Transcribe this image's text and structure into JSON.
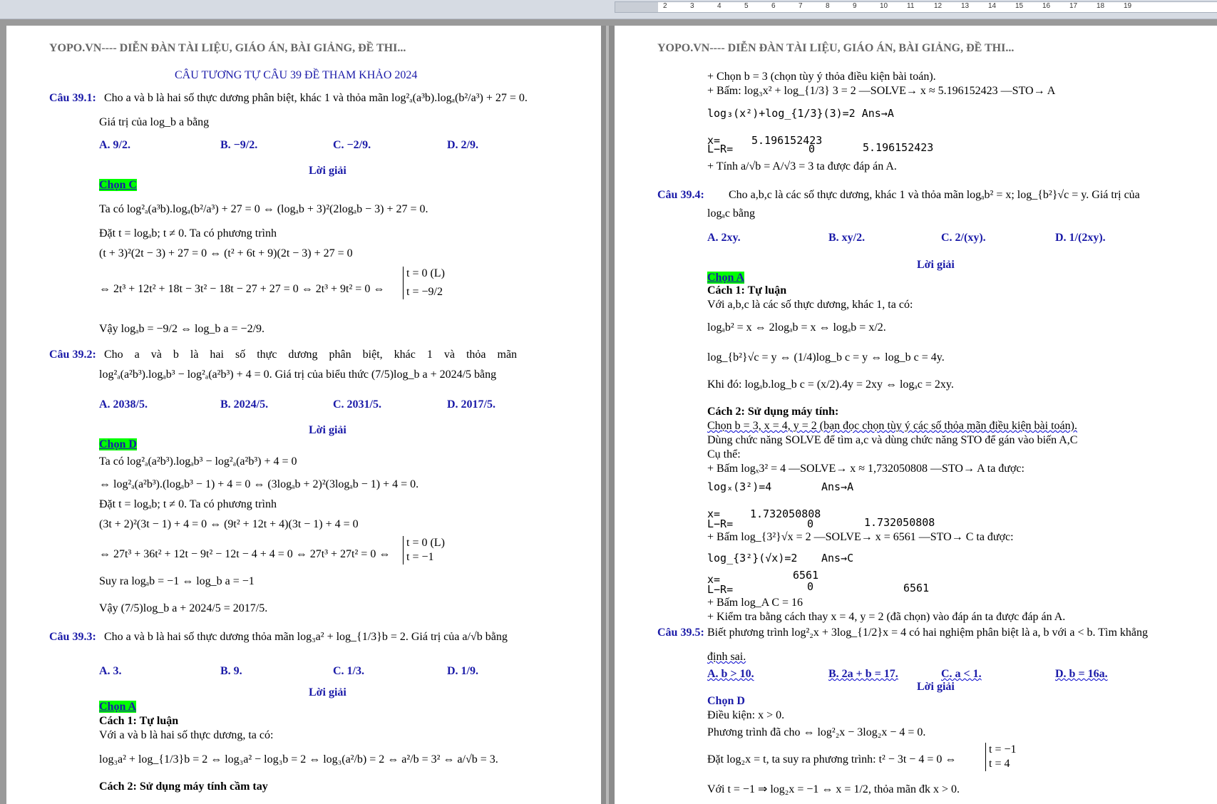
{
  "header_text": "YOPO.VN---- DIỄN ĐÀN TÀI LIỆU, GIÁO ÁN, BÀI GIẢNG, ĐỀ THI...",
  "ruler": {
    "numbers": [
      "2",
      "3",
      "4",
      "5",
      "6",
      "7",
      "8",
      "9",
      "10",
      "11",
      "12",
      "13",
      "14",
      "15",
      "16",
      "17",
      "18",
      "19"
    ]
  },
  "left": {
    "title": "CÂU TƯƠNG TỰ CÂU 39 ĐỀ THAM KHẢO 2024",
    "lines": [
      "Câu 39.1:",
      "Cho a và b là hai số thực dương phân biệt, khác 1 và thỏa mãn log²ₐ(a³b).logₐ(b²/a³) + 27 = 0.",
      "Giá trị của log_b a bằng",
      "A. 9/2.",
      "B. −9/2.",
      "C. −2/9.",
      "D. 2/9.",
      "Lời giải",
      "Chọn C",
      "Ta có log²ₐ(a³b).logₐ(b²/a³) + 27 = 0 ⇔ (logₐb + 3)²(2logₐb − 3) + 27 = 0.",
      "Đặt t = logₐb; t ≠ 0. Ta có phương trình",
      "(t + 3)²(2t − 3) + 27 = 0 ⇔ (t² + 6t + 9)(2t − 3) + 27 = 0",
      "⇔ 2t³ + 12t² + 18t − 3t² − 18t − 27 + 27 = 0 ⇔ 2t³ + 9t² = 0 ⇔",
      "t = 0 (L)",
      "t = −9/2",
      "Vậy logₐb = −9/2 ⇔ log_b a = −2/9.",
      "Câu 39.2:",
      "Cho a và b là hai số thực dương phân biệt, khác 1 và thỏa mãn",
      "log²ₐ(a²b³).logₐb³ − log²ₐ(a²b³) + 4 = 0. Giá trị của biểu thức (7/5)log_b a + 2024/5 bằng",
      "A. 2038/5.",
      "B. 2024/5.",
      "C. 2031/5.",
      "D. 2017/5.",
      "Lời giải",
      "Chọn D",
      "Ta có log²ₐ(a²b³).logₐb³ − log²ₐ(a²b³) + 4 = 0",
      "⇔ log²ₐ(a²b³).(logₐb³ − 1) + 4 = 0 ⇔ (3logₐb + 2)²(3logₐb − 1) + 4 = 0.",
      "Đặt t = logₐb; t ≠ 0. Ta có phương trình",
      "(3t + 2)²(3t − 1) + 4 = 0 ⇔ (9t² + 12t + 4)(3t − 1) + 4 = 0",
      "⇔ 27t³ + 36t² + 12t − 9t² − 12t − 4 + 4 = 0 ⇔ 27t³ + 27t² = 0 ⇔",
      "t = 0 (L)",
      "t = −1",
      "Suy ra logₐb = −1 ⇔ log_b a = −1",
      "Vậy (7/5)log_b a + 2024/5 = 2017/5.",
      "Câu 39.3:",
      "Cho a và b là hai số thực dương thỏa mãn log₃a² + log_{1/3}b = 2. Giá trị của a/√b bằng",
      "A. 3.",
      "B. 9.",
      "C. 1/3.",
      "D. 1/9.",
      "Lời giải",
      "Chọn A",
      "Cách 1: Tự luận",
      "Với a và b là hai số thực dương, ta có:",
      "log₃a² + log_{1/3}b = 2 ⇔ log₃a² − log₃b = 2 ⇔ log₃(a²/b) = 2 ⇔ a²/b = 3² ⇔ a/√b = 3.",
      "Cách 2: Sử dụng máy tính cầm tay"
    ]
  },
  "right": {
    "lines": [
      "+ Chọn b = 3 (chọn tùy ý thỏa điều kiện bài toán).",
      "+ Bấm: log₃x² + log_{1/3} 3 = 2 —SOLVE→ x ≈ 5.196152423 —STO→ A",
      "log₃(x²)+log_{1/3}(3)=2 Ans→A",
      "x=",
      "5.196152423",
      "L−R=",
      "0",
      "5.196152423",
      "+ Tính a/√b = A/√3 = 3 ta được đáp án A.",
      "Câu 39.4:",
      "Cho a,b,c là các số thực dương, khác 1 và thỏa mãn logₐb² = x; log_{b²}√c = y. Giá trị của",
      "logₐc bằng",
      "A. 2xy.",
      "B. xy/2.",
      "C. 2/(xy).",
      "D. 1/(2xy).",
      "Lời giải",
      "Chọn A",
      "Cách 1: Tự luận",
      "Với a,b,c là các số thực dương, khác 1, ta có:",
      "logₐb² = x ⇔ 2logₐb = x ⇔ logₐb = x/2.",
      "log_{b²}√c = y ⇔ (1/4)log_b c = y ⇔ log_b c = 4y.",
      "Khi đó: logₐb.log_b c = (x/2).4y = 2xy ⇔ logₐc = 2xy.",
      "Cách 2: Sử dụng máy tính:",
      "Chọn b = 3, x = 4, y = 2 (bạn đọc chọn tùy ý các số thỏa mãn điều kiện bài toán).",
      "Dùng chức năng SOLVE để tìm a,c và dùng chức năng STO để gán vào biến A,C",
      "Cụ thể:",
      "+ Bấm logₓ3² = 4 —SOLVE→ x ≈ 1,732050808 —STO→ A ta được:",
      "logₓ(3²)=4",
      "Ans→A",
      "x=",
      "1.732050808",
      "L−R=",
      "0",
      "1.732050808",
      "+ Bấm log_{3²}√x = 2 —SOLVE→ x = 6561 —STO→ C ta được:",
      "log_{3²}(√x)=2",
      "Ans→C",
      "x=",
      "6561",
      "L−R=",
      "0",
      "6561",
      "+ Bấm log_A C = 16",
      "+ Kiểm tra bằng cách thay x = 4, y = 2 (đã chọn) vào đáp án ta được đáp án A.",
      "Câu 39.5:",
      "Biết phương trình log²₂x + 3log_{1/2}x = 4 có hai nghiệm phân biệt là a, b với a < b. Tìm khẳng",
      "định sai.",
      "A. b > 10.",
      "B. 2a + b = 17.",
      "C. a < 1.",
      "D. b = 16a.",
      "Lời giải",
      "Chọn D",
      "Điều kiện: x > 0.",
      "Phương trình đã cho ⇔ log²₂x − 3log₂x − 4 = 0.",
      "Đặt log₂x = t, ta suy ra phương trình: t² − 3t − 4 = 0 ⇔",
      "t = −1",
      "t = 4",
      "Với t = −1 ⇒ log₂x = −1 ⇔ x = 1/2, thỏa mãn đk x > 0."
    ]
  }
}
